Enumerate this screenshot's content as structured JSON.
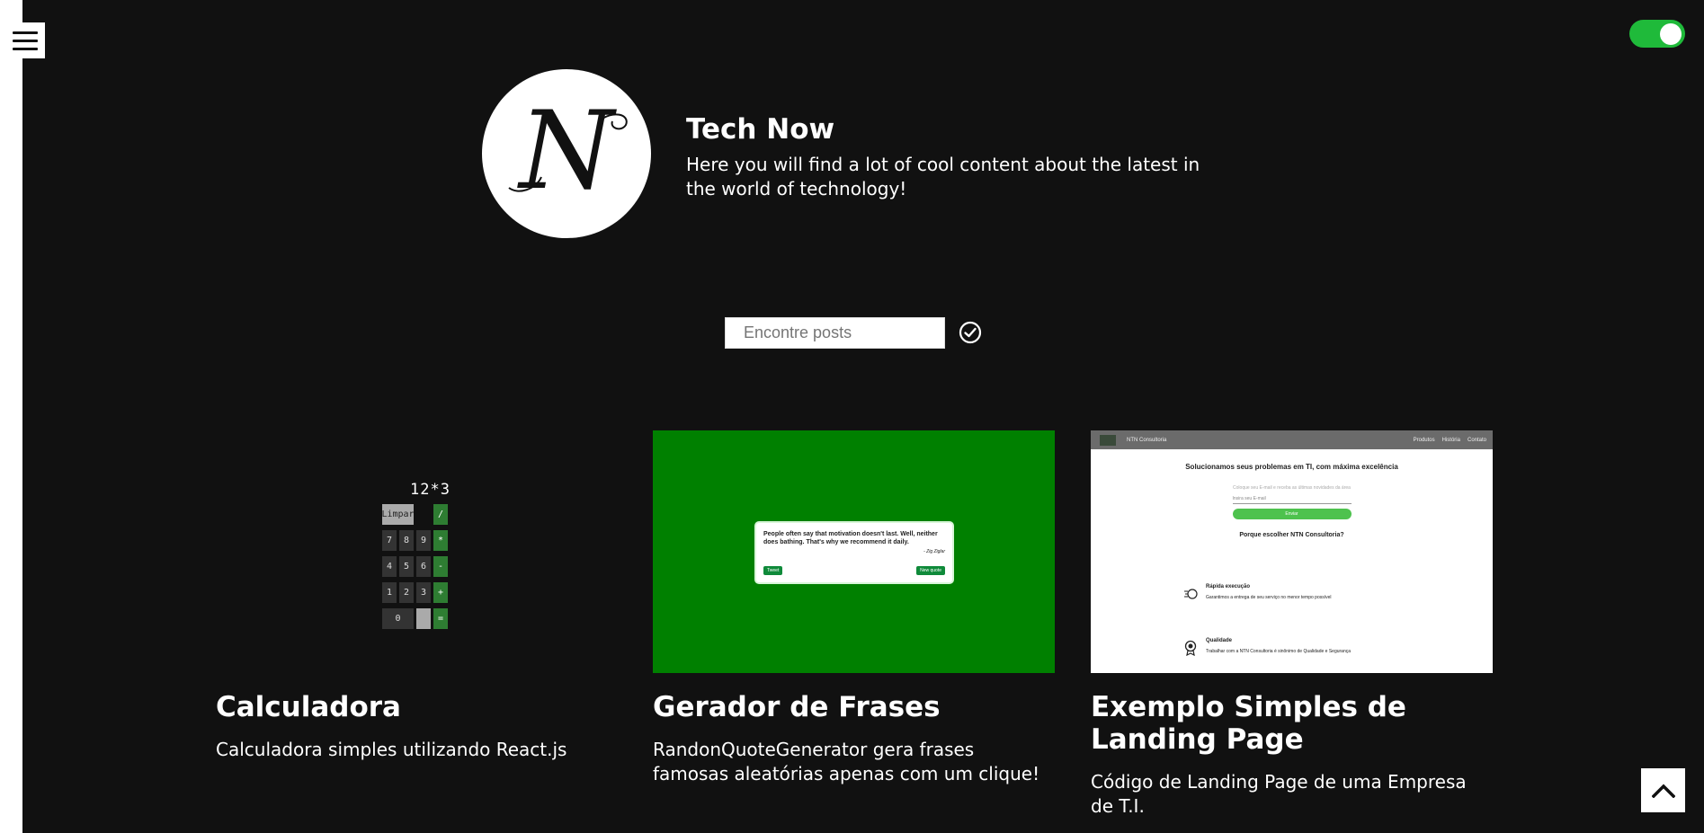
{
  "site": {
    "title": "Tech Now",
    "description": "Here you will find a lot of cool content about the latest in the world of technology!",
    "logo_letter": "N"
  },
  "header": {
    "menu_icon": "hamburger-menu-icon",
    "theme_toggle_state": "on",
    "accent_color": "#1fba3a"
  },
  "search": {
    "placeholder": "Encontre posts",
    "value": "",
    "submit_icon": "check-circle-icon"
  },
  "posts": [
    {
      "title": "Calculadora",
      "description": "Calculadora simples utilizando React.js",
      "thumbnail": {
        "display": "12*3",
        "keys": [
          "Limpar",
          "/",
          "7",
          "8",
          "9",
          "*",
          "4",
          "5",
          "6",
          "-",
          "1",
          "2",
          "3",
          "+",
          "0",
          "="
        ]
      }
    },
    {
      "title": "Gerador de Frases",
      "description": "RandonQuoteGenerator gera frases famosas aleatórias apenas com um clique!",
      "thumbnail": {
        "bg_color": "#008000",
        "quote": "People often say that motivation doesn't last. Well, neither does bathing. That's why we recommend it daily.",
        "author": "- Zig Ziglar",
        "tweet_label": "Tweet",
        "new_quote_label": "New quote"
      }
    },
    {
      "title": "Exemplo Simples de Landing Page",
      "description": "Código de Landing Page de uma Empresa de T.I.",
      "thumbnail": {
        "brand": "NTN Consultoria",
        "nav": [
          "Produtos",
          "História",
          "Contato"
        ],
        "headline": "Solucionamos seus problemas em TI, com máxima excelência",
        "email_hint": "Coloque seu E-mail e receba as últimas novidades da área",
        "email_placeholder": "Insira seu E-mail",
        "cta": "Enviar",
        "section_title": "Porque escolher NTN Consultoria?",
        "features": [
          {
            "title": "Rápida execução",
            "text": "Garantimos a entrega de seu serviço no menor tempo possível"
          },
          {
            "title": "Qualidade",
            "text": "Trabalhar com a NTN Consultoria é sinônimo de Qualidade e Segurança"
          }
        ]
      }
    }
  ],
  "scroll_top_icon": "chevron-up-icon"
}
